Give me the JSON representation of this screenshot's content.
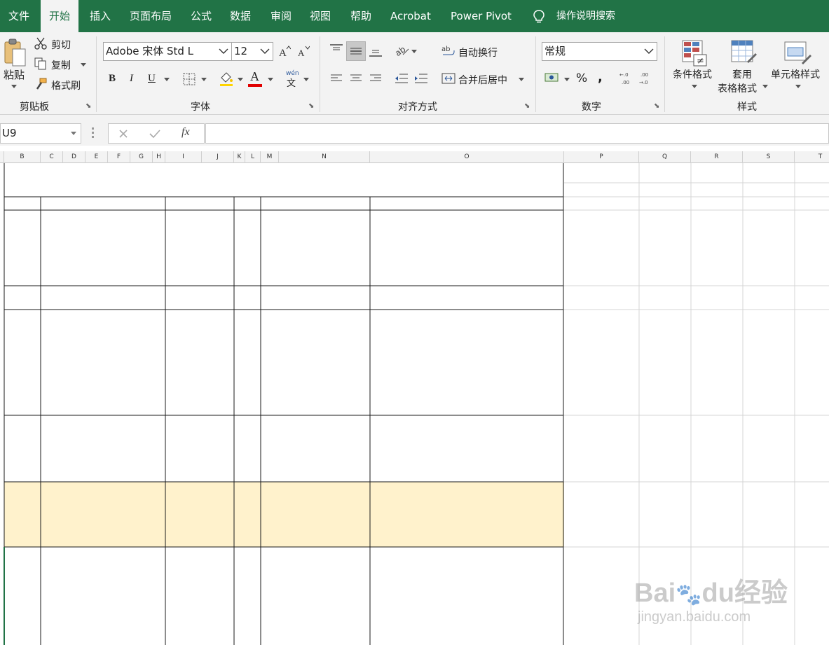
{
  "tabs": [
    {
      "label": "文件",
      "active": false
    },
    {
      "label": "开始",
      "active": true
    },
    {
      "label": "插入",
      "active": false
    },
    {
      "label": "页面布局",
      "active": false
    },
    {
      "label": "公式",
      "active": false
    },
    {
      "label": "数据",
      "active": false
    },
    {
      "label": "审阅",
      "active": false
    },
    {
      "label": "视图",
      "active": false
    },
    {
      "label": "帮助",
      "active": false
    },
    {
      "label": "Acrobat",
      "active": false
    },
    {
      "label": "Power Pivot",
      "active": false
    }
  ],
  "search": {
    "label": "操作说明搜索",
    "icon": "lightbulb-icon"
  },
  "clipboard": {
    "group": "剪贴板",
    "paste": "粘贴",
    "cut": "剪切",
    "copy": "复制",
    "format_painter": "格式刷"
  },
  "font": {
    "group": "字体",
    "name": "Adobe 宋体 Std L",
    "size": "12",
    "bold": "B",
    "italic": "I",
    "underline": "U",
    "font_color": "#e00000",
    "wen": "wén",
    "wen_char": "文"
  },
  "alignment": {
    "group": "对齐方式",
    "wrap": "自动换行",
    "merge": "合并后居中"
  },
  "number": {
    "group": "数字",
    "format": "常规",
    "percent": "%",
    "comma": ","
  },
  "styles": {
    "group": "样式",
    "conditional": "条件格式",
    "table_line1": "套用",
    "table_line2": "表格格式",
    "cell_styles": "单元格样式"
  },
  "formula_bar": {
    "name_box": "U9",
    "fx": "fx",
    "value": ""
  },
  "columns": [
    "B",
    "C",
    "D",
    "E",
    "F",
    "G",
    "H",
    "I",
    "J",
    "K",
    "L",
    "M",
    "N",
    "O",
    "P",
    "Q",
    "R",
    "S",
    "T"
  ],
  "watermark": {
    "brand": "Bai",
    "brand_suffix": "du",
    "brand_cn": "经验",
    "url": "jingyan.baidu.com"
  },
  "colors": {
    "accent": "#217346",
    "highlight_row": "#fff2cc",
    "grid": "#d4d4d4"
  }
}
